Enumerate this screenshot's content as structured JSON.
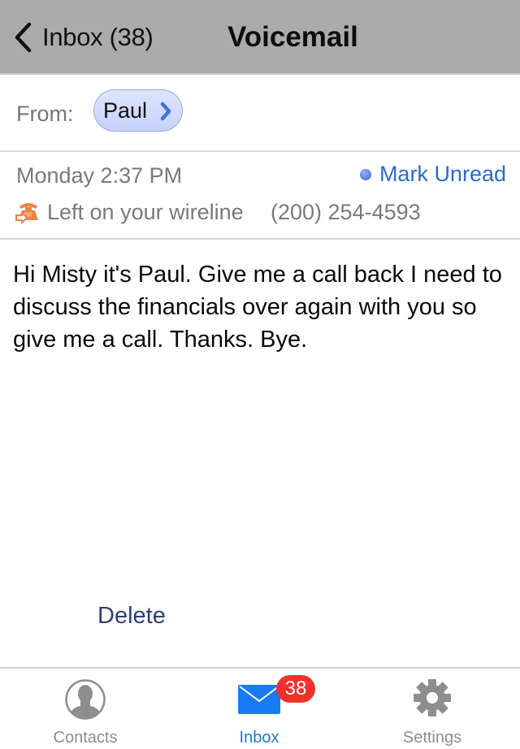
{
  "navbar": {
    "back_label": "Inbox (38)",
    "title": "Voicemail"
  },
  "from": {
    "label": "From:",
    "contact_name": "Paul"
  },
  "meta": {
    "date": "Monday 2:37 PM",
    "mark_unread_label": "Mark Unread",
    "wireline_text": "Left on your wireline",
    "phone_number": "(200) 254-4593"
  },
  "transcript": "Hi Misty it's Paul. Give me a call back I need to discuss the financials over again with you so give me a call. Thanks. Bye.",
  "actions": {
    "delete_label": "Delete"
  },
  "tabbar": {
    "tabs": [
      {
        "label": "Contacts",
        "icon": "contact-icon",
        "active": false
      },
      {
        "label": "Inbox",
        "icon": "envelope-icon",
        "active": true,
        "badge": "38"
      },
      {
        "label": "Settings",
        "icon": "gear-icon",
        "active": false
      }
    ]
  },
  "colors": {
    "navbar_bg": "#ababab",
    "accent_blue": "#1e78d6",
    "link_blue": "#2a6ad0",
    "badge_red": "#f0312b",
    "wireline_orange": "#ee8443"
  }
}
